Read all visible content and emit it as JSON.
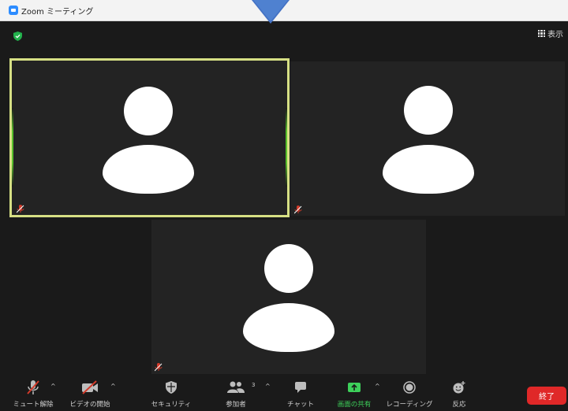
{
  "window": {
    "title": "Zoom ミーティング"
  },
  "header": {
    "view_label": "表示"
  },
  "participants": [
    {
      "id": "p1",
      "active": true,
      "muted": true
    },
    {
      "id": "p2",
      "active": false,
      "muted": true
    },
    {
      "id": "p3",
      "active": false,
      "muted": true
    }
  ],
  "toolbar": {
    "unmute": "ミュート解除",
    "start_video": "ビデオの開始",
    "security": "セキュリティ",
    "participants": "参加者",
    "participants_count": "3",
    "chat": "チャット",
    "share_screen": "画面の共有",
    "recording": "レコーディング",
    "reactions": "反応",
    "end": "終了"
  },
  "colors": {
    "active_border": "#d6df84",
    "share_green": "#3dd05a",
    "end_red": "#e02828",
    "muted_red": "#d23a2a",
    "pointer_blue": "#4472c4"
  }
}
